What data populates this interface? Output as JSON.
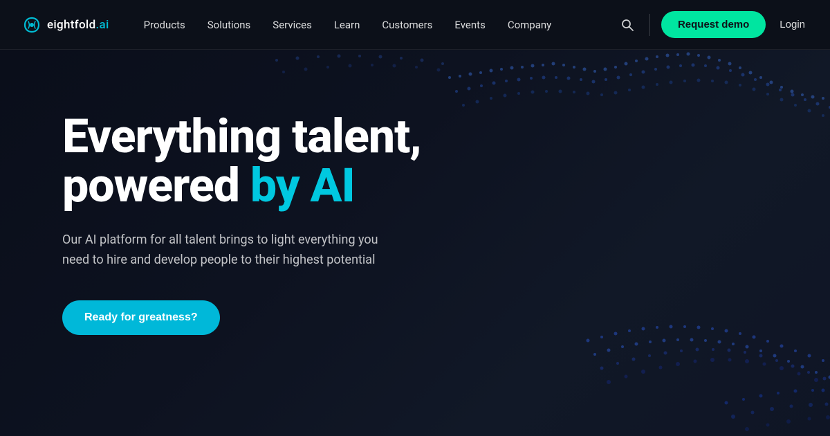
{
  "logo": {
    "text_before": "eightfold",
    "text_after": ".ai",
    "aria": "Eightfold AI"
  },
  "navbar": {
    "links": [
      {
        "label": "Products",
        "id": "products"
      },
      {
        "label": "Solutions",
        "id": "solutions"
      },
      {
        "label": "Services",
        "id": "services"
      },
      {
        "label": "Learn",
        "id": "learn"
      },
      {
        "label": "Customers",
        "id": "customers"
      },
      {
        "label": "Events",
        "id": "events"
      },
      {
        "label": "Company",
        "id": "company"
      }
    ],
    "demo_label": "Request demo",
    "login_label": "Login"
  },
  "hero": {
    "title_line1": "Everything talent,",
    "title_line2_plain": "powered ",
    "title_line2_colored1": "by ",
    "title_line2_colored2": "AI",
    "subtitle": "Our AI platform for all talent brings to light everything you need to hire and develop people to their highest potential",
    "cta_label": "Ready for greatness?",
    "colors": {
      "accent_cyan": "#00c8e0",
      "accent_green": "#00e5a0",
      "cta_blue": "#00b8d9"
    }
  }
}
